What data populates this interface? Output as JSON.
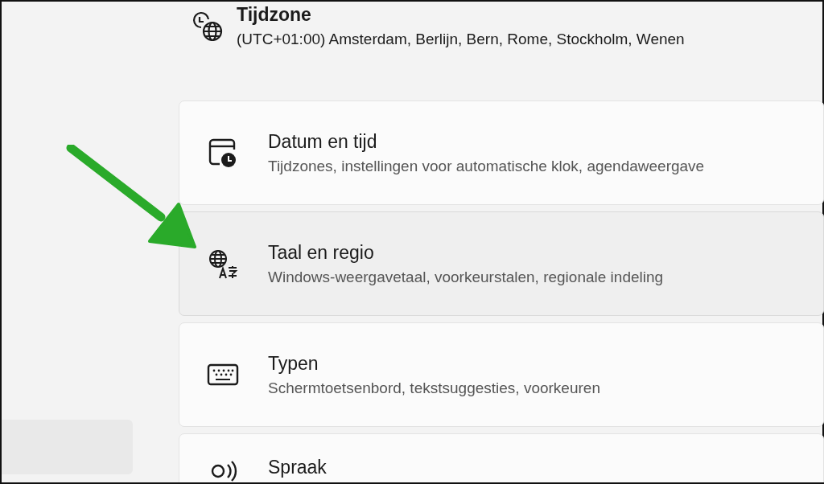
{
  "time_zone": {
    "title": "Tijdzone",
    "value": "(UTC+01:00) Amsterdam, Berlijn, Bern, Rome, Stockholm, Wenen"
  },
  "cards": [
    {
      "kind": "calendar",
      "title": "Datum en tijd",
      "subtitle": "Tijdzones, instellingen voor automatische klok, agendaweergave",
      "highlighted": false
    },
    {
      "kind": "language",
      "title": "Taal en regio",
      "subtitle": "Windows-weergavetaal, voorkeurstalen, regionale indeling",
      "highlighted": true
    },
    {
      "kind": "keyboard",
      "title": "Typen",
      "subtitle": "Schermtoetsenbord, tekstsuggesties, voorkeuren",
      "highlighted": false
    },
    {
      "kind": "speech",
      "title": "Spraak",
      "highlighted": false
    }
  ]
}
